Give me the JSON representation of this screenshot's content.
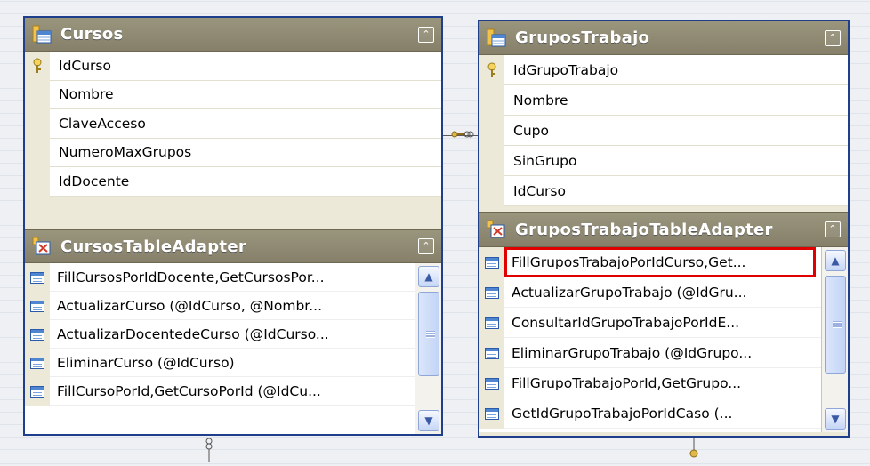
{
  "left_table": {
    "title": "Cursos",
    "columns": [
      {
        "name": "IdCurso",
        "key": true
      },
      {
        "name": "Nombre",
        "key": false
      },
      {
        "name": "ClaveAcceso",
        "key": false
      },
      {
        "name": "NumeroMaxGrupos",
        "key": false
      },
      {
        "name": "IdDocente",
        "key": false
      }
    ],
    "adapter": {
      "title": "CursosTableAdapter",
      "queries": [
        "FillCursosPorIdDocente,GetCursosPor...",
        "ActualizarCurso (@IdCurso, @Nombr...",
        "ActualizarDocentedeCurso (@IdCurso...",
        "EliminarCurso (@IdCurso)",
        "FillCursoPorId,GetCursoPorId (@IdCu..."
      ]
    }
  },
  "right_table": {
    "title": "GruposTrabajo",
    "columns": [
      {
        "name": "IdGrupoTrabajo",
        "key": true
      },
      {
        "name": "Nombre",
        "key": false
      },
      {
        "name": "Cupo",
        "key": false
      },
      {
        "name": "SinGrupo",
        "key": false
      },
      {
        "name": "IdCurso",
        "key": false
      }
    ],
    "adapter": {
      "title": "GruposTrabajoTableAdapter",
      "queries": [
        "FillGruposTrabajoPorIdCurso,Get...",
        "ActualizarGrupoTrabajo (@IdGru...",
        "ConsultarIdGrupoTrabajoPorIdE...",
        "EliminarGrupoTrabajo (@IdGrupo...",
        "FillGrupoTrabajoPorId,GetGrupo...",
        "GetIdGrupoTrabajoPorIdCaso (..."
      ]
    }
  },
  "colors": {
    "header_bg": "#8f8a73",
    "border": "#1f3f8c",
    "highlight": "#e00000"
  }
}
